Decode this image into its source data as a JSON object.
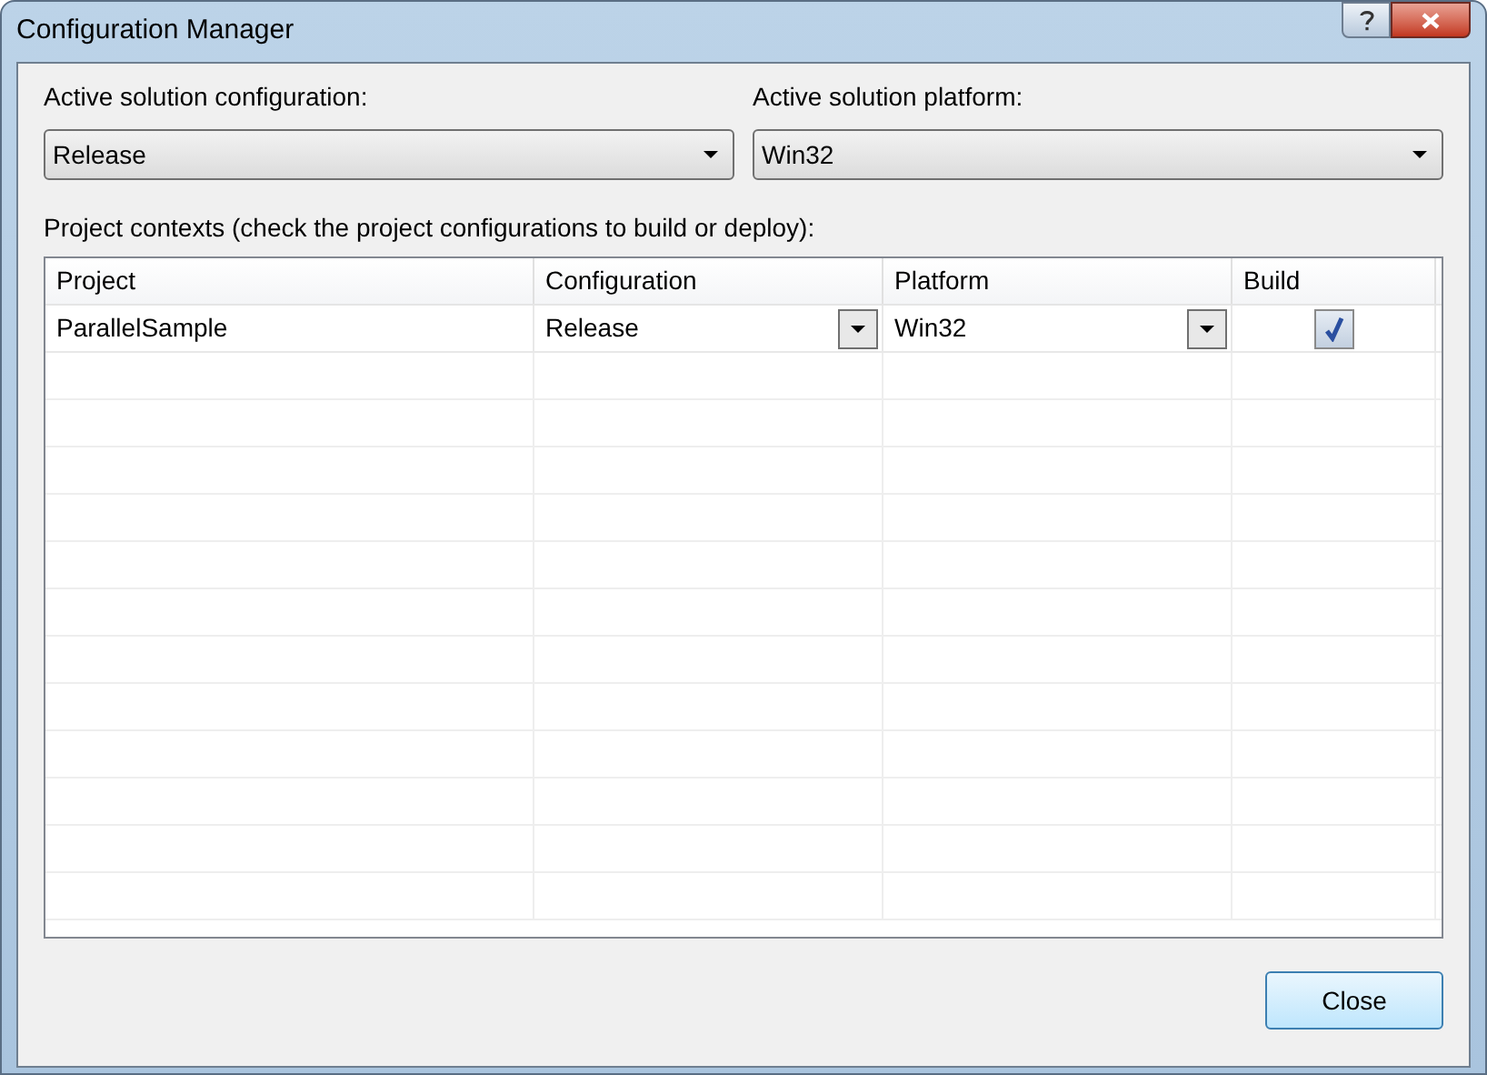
{
  "window": {
    "title": "Configuration Manager"
  },
  "solution_configuration": {
    "label": "Active solution configuration:",
    "value": "Release"
  },
  "solution_platform": {
    "label": "Active solution platform:",
    "value": "Win32"
  },
  "project_contexts": {
    "label": "Project contexts (check the project configurations to build or deploy):",
    "columns": [
      "Project",
      "Configuration",
      "Platform",
      "Build"
    ],
    "rows": [
      {
        "project": "ParallelSample",
        "configuration": "Release",
        "platform": "Win32",
        "build": true
      }
    ]
  },
  "buttons": [
    "Close"
  ]
}
